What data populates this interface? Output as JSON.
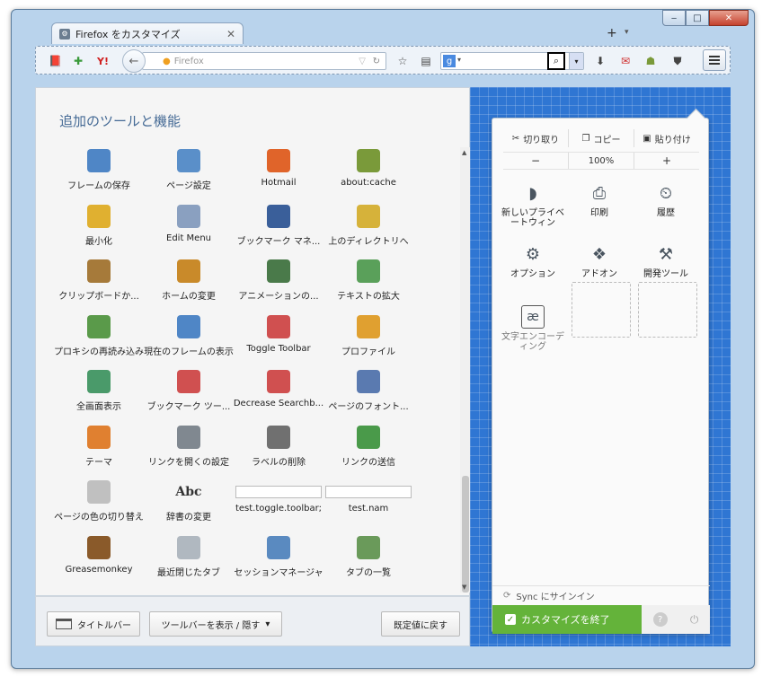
{
  "window": {
    "tab_title": "Firefox をカスタマイズ",
    "tab_icon": "gear-icon",
    "new_tab": "+",
    "controls": {
      "minimize": "‒",
      "maximize": "□",
      "close": "✕"
    }
  },
  "toolbar": {
    "url_placeholder": "Firefox",
    "search_engine": "g",
    "search_go": "⌕",
    "icons": [
      "bookmark-icon",
      "addon-puzzle-icon",
      "yahoo-icon",
      "back-icon",
      "star-icon",
      "clipboard-icon",
      "download-icon",
      "gmail-icon",
      "greasemonkey-icon",
      "shield-icon",
      "menu-icon"
    ]
  },
  "palette": {
    "title": "追加のツールと機能",
    "items": [
      {
        "label": "フレームの保存",
        "icon": "save-frame-icon",
        "color": "#4f86c6"
      },
      {
        "label": "ページ設定",
        "icon": "page-setup-icon",
        "color": "#5a8fc9"
      },
      {
        "label": "Hotmail",
        "icon": "windows-logo-icon",
        "color": "#e0642a"
      },
      {
        "label": "about:cache",
        "icon": "cache-icon",
        "color": "#7a9a3a"
      },
      {
        "label": "最小化",
        "icon": "minimize-icon",
        "color": "#e0b030"
      },
      {
        "label": "Edit Menu",
        "icon": "edit-menu-icon",
        "color": "#8aa0c0"
      },
      {
        "label": "ブックマーク マネ...",
        "icon": "bookmark-manager-icon",
        "color": "#3a5f9a"
      },
      {
        "label": "上のディレクトリへ",
        "icon": "folder-up-icon",
        "color": "#d6b23a"
      },
      {
        "label": "クリップボードか...",
        "icon": "clipboard-paste-icon",
        "color": "#a67a3a"
      },
      {
        "label": "ホームの変更",
        "icon": "home-change-icon",
        "color": "#c98a2a"
      },
      {
        "label": "アニメーションの...",
        "icon": "animation-icon",
        "color": "#4a7a4a"
      },
      {
        "label": "テキストの拡大",
        "icon": "zoom-text-icon",
        "color": "#5aa05a"
      },
      {
        "label": "プロキシの再読み込み",
        "icon": "proxy-reload-icon",
        "color": "#5a9a4a"
      },
      {
        "label": "現在のフレームの表示",
        "icon": "show-frame-icon",
        "color": "#4f86c6"
      },
      {
        "label": "Toggle Toolbar",
        "icon": "toggle-toolbar-icon",
        "color": "#d05050"
      },
      {
        "label": "プロファイル",
        "icon": "profile-icon",
        "color": "#e0a030"
      },
      {
        "label": "全画面表示",
        "icon": "fullscreen-icon",
        "color": "#4a9a6a"
      },
      {
        "label": "ブックマーク ツー...",
        "icon": "bookmark-toolbar-icon",
        "color": "#d05050"
      },
      {
        "label": "Decrease Searchb...",
        "icon": "decrease-search-icon",
        "color": "#d05050"
      },
      {
        "label": "ページのフォント...",
        "icon": "page-font-icon",
        "color": "#5a7ab0"
      },
      {
        "label": "テーマ",
        "icon": "theme-icon",
        "color": "#e08030"
      },
      {
        "label": "リンクを開くの設定",
        "icon": "open-link-icon",
        "color": "#808890"
      },
      {
        "label": "ラベルの削除",
        "icon": "remove-label-icon",
        "color": "#707070"
      },
      {
        "label": "リンクの送信",
        "icon": "send-link-icon",
        "color": "#4a9a4a"
      },
      {
        "label": "ページの色の切り替え",
        "icon": "page-color-icon",
        "color": "#c0c0c0"
      },
      {
        "label": "辞書の変更",
        "icon": "dictionary-icon",
        "color": "#333333"
      },
      {
        "label": "test.toggle.toolbar;",
        "icon": "",
        "color": ""
      },
      {
        "label": "test.nam",
        "icon": "",
        "color": ""
      },
      {
        "label": "Greasemonkey",
        "icon": "greasemonkey-icon",
        "color": "#8a5a2a"
      },
      {
        "label": "最近閉じたタブ",
        "icon": "recent-tabs-icon",
        "color": "#b0b8c0"
      },
      {
        "label": "セッションマネージャ",
        "icon": "session-manager-icon",
        "color": "#5a8ac0"
      },
      {
        "label": "タブの一覧",
        "icon": "tab-list-icon",
        "color": "#6a9a5a"
      }
    ],
    "dictionary_glyph": "Abc"
  },
  "footer": {
    "titlebar_label": "タイトルバー",
    "toolbars_label": "ツールバーを表示 / 隠す",
    "restore_label": "既定値に戻す"
  },
  "panel": {
    "cut": "切り取り",
    "copy": "コピー",
    "paste": "貼り付け",
    "zoom_out": "−",
    "zoom_level": "100%",
    "zoom_in": "+",
    "items": [
      {
        "label": "新しいプライベートウィン",
        "icon": "private-window-icon",
        "glyph": "◗"
      },
      {
        "label": "印刷",
        "icon": "print-icon",
        "glyph": "⎙"
      },
      {
        "label": "履歴",
        "icon": "history-icon",
        "glyph": "⏲"
      },
      {
        "label": "オプション",
        "icon": "options-gear-icon",
        "glyph": "⚙"
      },
      {
        "label": "アドオン",
        "icon": "addons-puzzle-icon",
        "glyph": "❖"
      },
      {
        "label": "開発ツール",
        "icon": "developer-wrench-icon",
        "glyph": "⚒"
      },
      {
        "label": "文字エンコーディング",
        "icon": "character-encoding-icon",
        "glyph": "æ"
      }
    ],
    "sync_label": "Sync にサインイン",
    "exit_label": "カスタマイズを終了",
    "help": "?",
    "quit": "⏻"
  }
}
